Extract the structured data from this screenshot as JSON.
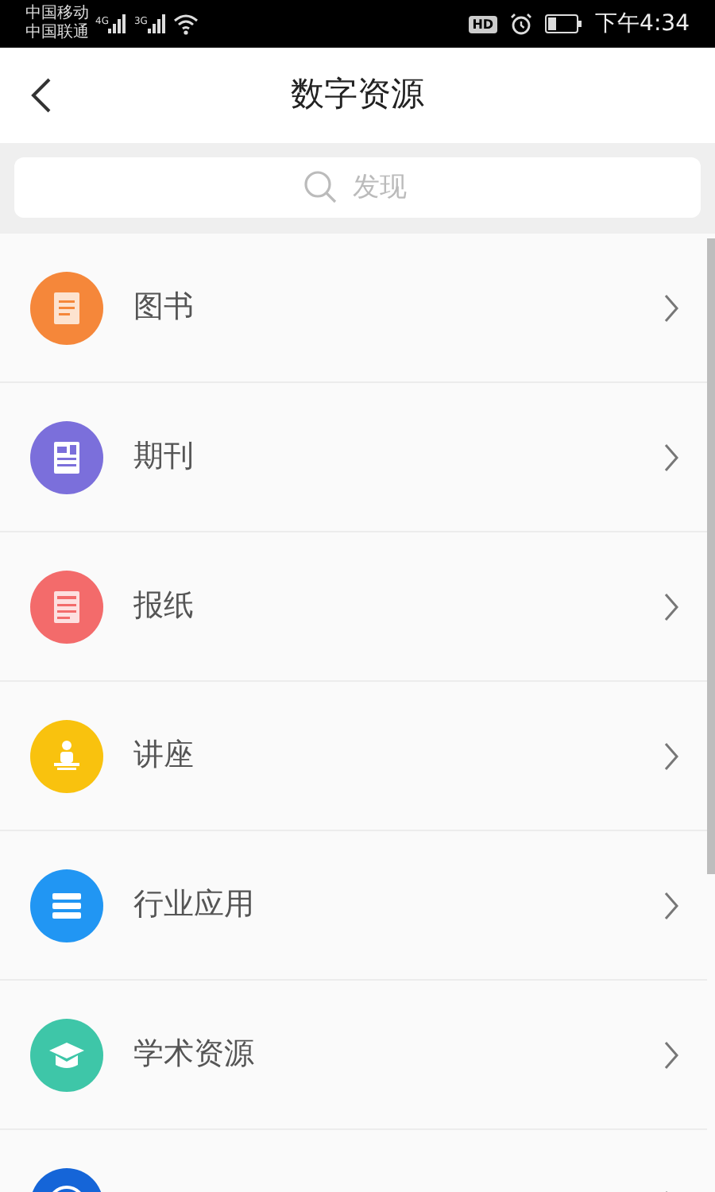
{
  "status_bar": {
    "carriers": [
      "中国移动",
      "中国联通"
    ],
    "networks": [
      "4G",
      "3G"
    ],
    "hd": "HD",
    "time": "下午4:34"
  },
  "header": {
    "title": "数字资源"
  },
  "search": {
    "placeholder": "发现"
  },
  "items": [
    {
      "kind": "book",
      "label": "图书",
      "color": "#f5873a"
    },
    {
      "kind": "journal",
      "label": "期刊",
      "color": "#7b6fdb"
    },
    {
      "kind": "newspaper",
      "label": "报纸",
      "color": "#f36b6b"
    },
    {
      "kind": "lecture",
      "label": "讲座",
      "color": "#f9c20e"
    },
    {
      "kind": "industry",
      "label": "行业应用",
      "color": "#2196f3"
    },
    {
      "kind": "academic",
      "label": "学术资源",
      "color": "#3ec6a8"
    },
    {
      "kind": "reading",
      "color": "#1565d8"
    }
  ]
}
